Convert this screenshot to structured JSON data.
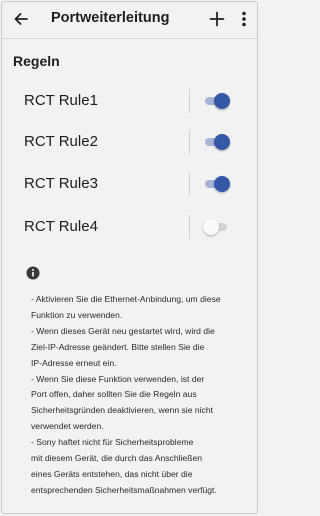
{
  "header": {
    "title": "Portweiterleitung",
    "back_icon": "back-arrow-icon",
    "add_icon": "plus-icon",
    "more_icon": "more-vert-icon"
  },
  "section": {
    "title": "Regeln"
  },
  "rules": [
    {
      "label": "RCT Rule1",
      "enabled": true
    },
    {
      "label": "RCT Rule2",
      "enabled": true
    },
    {
      "label": "RCT Rule3",
      "enabled": true
    },
    {
      "label": "RCT Rule4",
      "enabled": false
    }
  ],
  "info": {
    "icon": "info-icon",
    "lines": [
      "- Aktivieren Sie die Ethernet-Anbindung, um diese",
      "Funktion zu verwenden.",
      "- Wenn dieses Gerät neu gestartet wird, wird die",
      "Ziel-IP-Adresse geändert. Bitte stellen Sie die",
      "IP-Adresse erneut ein.",
      "- Wenn Sie diese Funktion verwenden, ist der",
      "Port offen, daher sollten Sie die Regeln aus",
      "Sicherheitsgründen deaktivieren, wenn sie nicht",
      "verwendet werden.",
      "- Sony haftet nicht für Sicherheitsprobleme",
      "mit diesem Gerät, die durch das Anschließen",
      "eines Geräts entstehen, das nicht über die",
      "entsprechenden Sicherheitsmaßnahmen verfügt."
    ]
  },
  "colors": {
    "accent": "#3457a8",
    "accent_track": "#a8b5d8",
    "background": "#f2f2f2"
  }
}
